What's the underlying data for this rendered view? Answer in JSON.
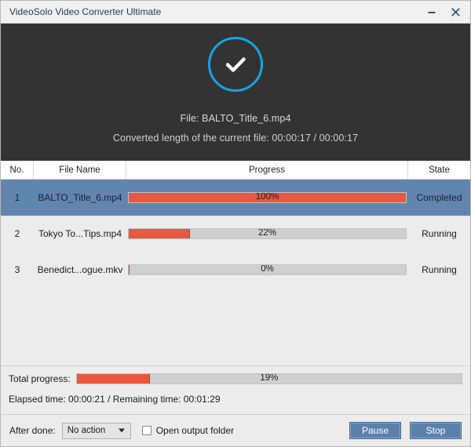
{
  "titlebar": {
    "title": "VideoSolo Video Converter Ultimate",
    "minimize_icon": "minimize-icon",
    "close_icon": "close-icon"
  },
  "hero": {
    "status_icon": "check-circle-icon",
    "accent_color": "#13a5e8",
    "background_color": "#333333",
    "file_line": "File: BALTO_Title_6.mp4",
    "converted_line": "Converted length of the current file: 00:00:17 / 00:00:17"
  },
  "table": {
    "columns": [
      "No.",
      "File Name",
      "Progress",
      "State"
    ],
    "rows": [
      {
        "no": "1",
        "file_name": "BALTO_Title_6.mp4",
        "progress_label": "100%",
        "progress_value": 100,
        "state": "Completed",
        "selected": true
      },
      {
        "no": "2",
        "file_name": "Tokyo To...Tips.mp4",
        "progress_label": "22%",
        "progress_value": 22,
        "state": "Running",
        "selected": false
      },
      {
        "no": "3",
        "file_name": "Benedict...ogue.mkv",
        "progress_label": "0%",
        "progress_value": 0,
        "state": "Running",
        "selected": false
      }
    ],
    "selected_row_color": "#6285ad",
    "progress_fill_color": "#e8573f",
    "progress_track_color": "#cfcfcf"
  },
  "totals": {
    "label": "Total progress:",
    "progress_label": "19%",
    "progress_value": 19,
    "time_line": "Elapsed time: 00:00:21 / Remaining time: 00:01:29"
  },
  "footer": {
    "after_done_label": "After done:",
    "after_done_value": "No action",
    "caret_icon": "chevron-down-icon",
    "open_folder_label": "Open output folder",
    "open_folder_checked": false,
    "pause_label": "Pause",
    "stop_label": "Stop",
    "button_color": "#5b81ab"
  }
}
